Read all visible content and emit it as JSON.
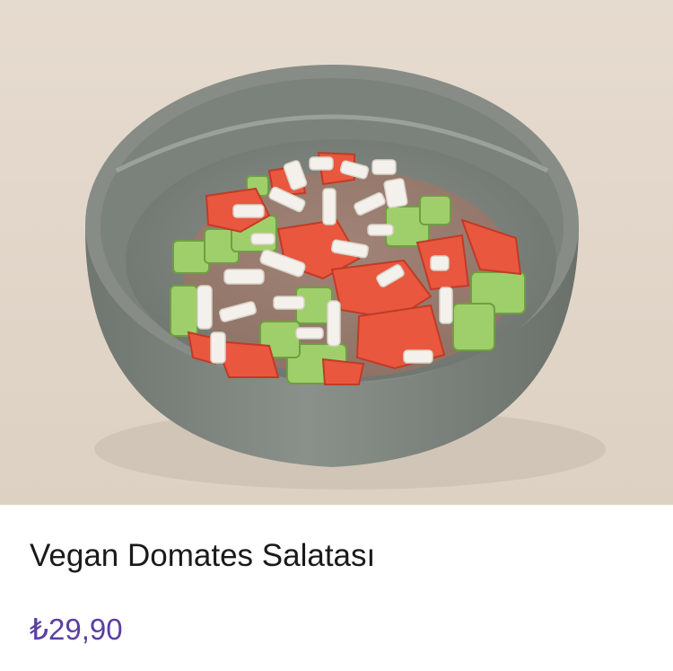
{
  "product": {
    "image_subject": "salad-bowl-image",
    "name": "Vegan Domates Salatası",
    "price": "₺29,90"
  },
  "colors": {
    "background": "#ffffff",
    "title": "#1a1a1a",
    "price": "#5b3fa3",
    "photo_backdrop": "#e2d7cb",
    "bowl": "#7f857f",
    "tomato": "#e9573f",
    "cucumber": "#9fcf6a",
    "onion": "#f4f1ec"
  }
}
